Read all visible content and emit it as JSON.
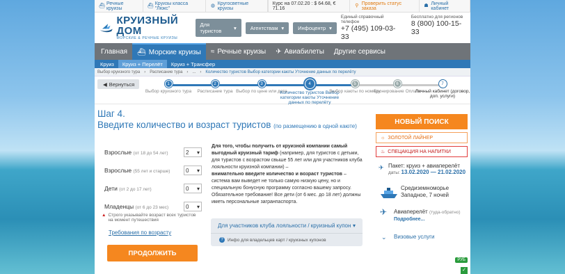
{
  "topbar": {
    "sea_cruises": "Речные круизы",
    "lux_cruises": "Круизы класса \"Люкс\"",
    "world_cruises": "Кругосветные круизы",
    "rate": "Курс на 07.02.20 : $ 64.68, € 71.16",
    "order_status": "Проверить статус заказа",
    "cabinet": "Личный кабинет"
  },
  "logo": {
    "title": "КРУИЗНЫЙ ДОМ",
    "subtitle": "МОРСКИЕ & РЕЧНЫЕ КРУИЗЫ"
  },
  "header_menu": [
    "Для туристов",
    "Агентствам",
    "Инфоцентр"
  ],
  "phones": [
    {
      "label": "Единый справочный телефон",
      "value": "+7 (495) 109-03-33"
    },
    {
      "label": "Бесплатно для регионов",
      "value": "8 (800) 100-15-33"
    }
  ],
  "nav": {
    "items": [
      "Главная",
      "Морские круизы",
      "Речные круизы",
      "Авиабилеты",
      "Другие сервисы"
    ],
    "active": 1
  },
  "subnav": {
    "items": [
      "Круиз",
      "Круиз + Перелёт",
      "Круиз + Трансфер"
    ],
    "active": 1
  },
  "breadcrumb": [
    "Выбор круизного тура",
    "Расписание тура",
    "...",
    "Количество туристов Выбор категории каюты Уточнение данных по перелёту"
  ],
  "back_label": "Вернуться",
  "steps": [
    {
      "n": "1",
      "label": "Выбор круизного тура"
    },
    {
      "n": "2",
      "label": "Расписание тура"
    },
    {
      "n": "3",
      "label": "Выбор по цене или дате"
    },
    {
      "n": "4",
      "label": "Количество туристов Выбор категории каюты Уточнение данных по перелёту"
    },
    {
      "n": "5",
      "label": "Выбор каюты по номеру"
    },
    {
      "n": "6",
      "label": "Бронирование Оплата"
    },
    {
      "n": "7",
      "label": "Личный кабинет (договор, доп. услуги)"
    }
  ],
  "step_title": "Шаг 4.",
  "step_heading": "Введите количество и возраст туристов",
  "step_note": "(по размещению в одной каюте)",
  "form": [
    {
      "label": "Взрослые",
      "hint": "(от 18 до 54 лет)",
      "value": "2"
    },
    {
      "label": "Взрослые",
      "hint": "(55 лет и старше)",
      "value": "0"
    },
    {
      "label": "Дети",
      "hint": "(от 2 до 17 лет)",
      "value": "0"
    },
    {
      "label": "Младенцы",
      "hint": "(от 6 до 23 мес)",
      "value": "0"
    }
  ],
  "warning": "Строго указывайте возраст всех туристов на момент путешествия",
  "requirements_link": "Требования по возрасту",
  "continue_button": "ПРОДОЛЖИТЬ",
  "info": {
    "p1_bold": "Для того, чтобы получить от круизной компании самый выгодный круизный тариф",
    "p1_rest": "(например, для туристов с детьми, для туристов с возрастом свыше 55 лет или для участников клуба лояльности круизной компании) –",
    "p2_bold": "внимательно введите количество и возраст туристов",
    "p2_rest": "– система вам выведет не только самую низкую цену, но и специальную бонусную программу согласно вашему запросу.",
    "p3": "Обязательное требование! Все дети (от 6 мес. до 18 лет) должны иметь персональные загранпаспорта."
  },
  "loyalty": {
    "title": "Для участников клуба лояльности / круизный купон",
    "info": "Инфо для владельцев карт / круизных купонов"
  },
  "sidebar": {
    "new_search": "НОВЫЙ ПОИСК",
    "promo1": "ЗОЛОТОЙ ЛАЙНЕР",
    "promo2": "СПЕЦАКЦИЯ НА НАПИТКИ",
    "package_label": "Пакет: круиз + авиаперелёт",
    "dates_label": "даты:",
    "dates": "13.02.2020 — 21.02.2020",
    "route": "Средиземноморье Западное, 7 ночей",
    "flight": "Авиаперелёт",
    "flight_note": "(туда-обратно)",
    "more": "Подробнее...",
    "visa": "Визовые услуги",
    "currency": "РУБ"
  },
  "colors": {
    "accent": "#2f78b7",
    "orange": "#f5871f",
    "nav": "#6f7479"
  }
}
